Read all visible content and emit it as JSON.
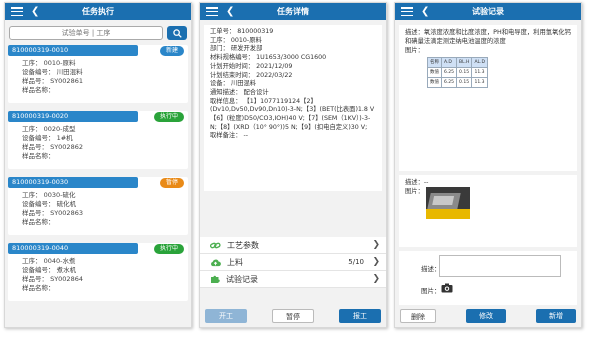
{
  "colors": {
    "primary": "#1b6fb0",
    "card_bar": "#2a86c9",
    "status_green": "#2aa33a",
    "status_orange": "#e98a17"
  },
  "screen1": {
    "title": "任务执行",
    "search": {
      "placeholder": "试验单号 | 工序",
      "button_icon": "search-icon"
    },
    "tasks": [
      {
        "id": "810000319-0010",
        "status": "新建",
        "status_color": "#2a86c9",
        "process": "工序： 0010-原料",
        "device": "设备编号： 川田混料",
        "sample": "样品号： SY002861",
        "sample_name": "样品名称："
      },
      {
        "id": "810000319-0020",
        "status": "执行中",
        "status_color": "#2aa33a",
        "process": "工序： 0020-成型",
        "device": "设备编号： 1#机",
        "sample": "样品号： SY002862",
        "sample_name": "样品名称："
      },
      {
        "id": "810000319-0030",
        "status": "暂停",
        "status_color": "#e98a17",
        "process": "工序： 0030-硫化",
        "device": "设备编号： 硫化机",
        "sample": "样品号： SY002863",
        "sample_name": "样品名称："
      },
      {
        "id": "810000319-0040",
        "status": "执行中",
        "status_color": "#2aa33a",
        "process": "工序： 0040-水煮",
        "device": "设备编号： 煮水机",
        "sample": "样品号： SY002864",
        "sample_name": "样品名称："
      }
    ]
  },
  "screen2": {
    "title": "任务详情",
    "details": [
      "工单号： 810000319",
      "工序： 0010-原料",
      "部门： 研发开发部",
      "材料规格编号： 1U1653/3000 CG1600",
      "计划开始时间： 2021/12/09",
      "计划结束时间： 2022/03/22",
      "设备： 川田混料",
      "通知描述： 配合设计",
      "取样信息： 【1】1077119124【2】(Dv10,Dv50,Dv90,Dn10)-3-N;【3】(BET(比表面)1.8 V【6】(粒度)D50/CO3,IOH)40 V;【7】(SEM（1KV）)-3-N;【8】(XRD（10° 90°))5 N;【9】(扣电自定义)30 V;",
      "取样备注： --"
    ],
    "menu": [
      {
        "label": "工艺参数",
        "icon": "link-icon",
        "count": ""
      },
      {
        "label": "上料",
        "icon": "cloud-upload-icon",
        "count": "5/10"
      },
      {
        "label": "试验记录",
        "icon": "puzzle-icon",
        "count": ""
      }
    ],
    "buttons": {
      "start": "开工",
      "pause": "暂停",
      "finish": "报工"
    }
  },
  "screen3": {
    "title": "试验记录",
    "record1": {
      "desc_label": "描述：",
      "desc_text": "氧浓度浓度和比度浓度，PH和电导度，利用氢氧化钙和碘量法滴定测定纳电池温度的浓度",
      "image_label": "图片：",
      "table": [
        [
          "名称",
          "A.D",
          "BL.H",
          "AL.D"
        ],
        [
          "数值",
          "6.25",
          "0.15",
          "11.3"
        ],
        [
          "数值",
          "6.25",
          "0.15",
          "11.3"
        ]
      ]
    },
    "record2": {
      "desc_label": "描述：",
      "desc_text": "--",
      "image_label": "图片："
    },
    "form": {
      "desc_label": "描述：",
      "image_label": "图片："
    },
    "buttons": {
      "delete": "删除",
      "edit": "修改",
      "add": "新增"
    }
  }
}
